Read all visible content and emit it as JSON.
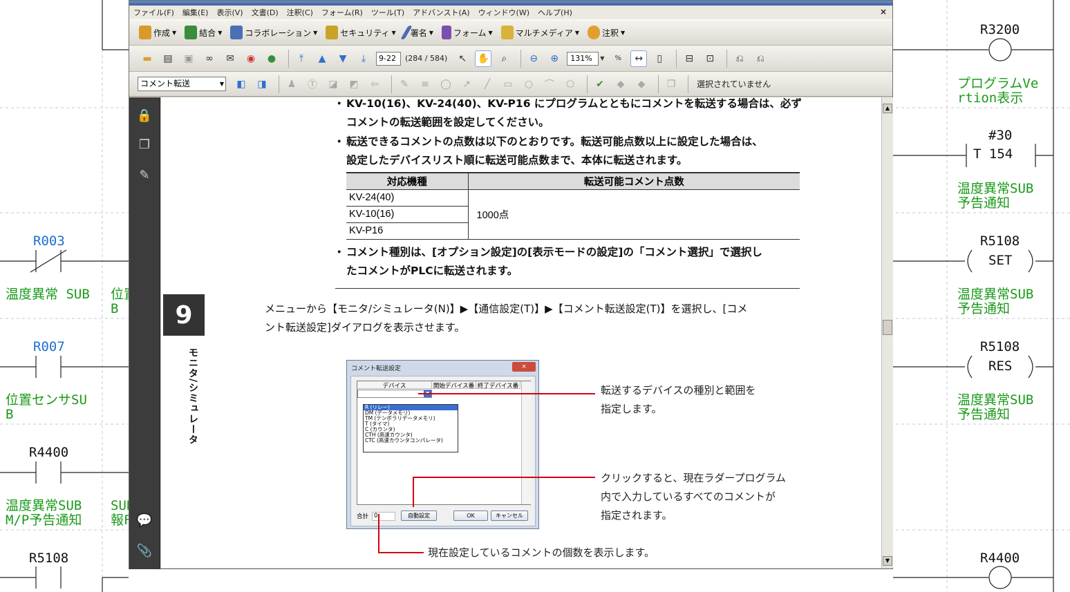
{
  "ladder": {
    "left_labels": [
      {
        "text": "R003",
        "color": "#1e6fd0"
      },
      {
        "text": "温度異常 SUB",
        "color": "#1a9a1a"
      },
      {
        "text": "位置\nB",
        "color": "#1a9a1a"
      },
      {
        "text": "R007",
        "color": "#1e6fd0"
      },
      {
        "text": "位置センサSU\nB",
        "color": "#1a9a1a"
      },
      {
        "text": "R4400",
        "color": "#111111"
      },
      {
        "text": "温度異常SUB\nM/P予告通知",
        "color": "#1a9a1a"
      },
      {
        "text": "SUB\n報F",
        "color": "#1a9a1a"
      },
      {
        "text": "R5108",
        "color": "#111111"
      }
    ],
    "right_labels": [
      {
        "text": "R3200",
        "color": "#111111"
      },
      {
        "text": "プログラムVe\nrtion表示",
        "color": "#1a9a1a"
      },
      {
        "text": "#30",
        "color": "#111111"
      },
      {
        "text": "T 154",
        "color": "#111111"
      },
      {
        "text": "温度異常SUB\n予告通知",
        "color": "#1a9a1a"
      },
      {
        "text": "R5108",
        "color": "#111111"
      },
      {
        "text": "SET",
        "color": "#111111"
      },
      {
        "text": "温度異常SUB\n予告通知",
        "color": "#1a9a1a"
      },
      {
        "text": "R5108",
        "color": "#111111"
      },
      {
        "text": "RES",
        "color": "#111111"
      },
      {
        "text": "温度異常SUB\n予告通知",
        "color": "#1a9a1a"
      },
      {
        "text": "R4400",
        "color": "#111111"
      }
    ]
  },
  "acrobat": {
    "menu": [
      "ファイル(F)",
      "編集(E)",
      "表示(V)",
      "文書(D)",
      "注釈(C)",
      "フォーム(R)",
      "ツール(T)",
      "アドバンスト(A)",
      "ウィンドウ(W)",
      "ヘルプ(H)"
    ],
    "menu_close": "×",
    "tasks": [
      {
        "label": "作成",
        "icon": "create-pdf-icon",
        "color": "#d89a2b"
      },
      {
        "label": "結合",
        "icon": "combine-icon",
        "color": "#3a8d3a"
      },
      {
        "label": "コラボレーション",
        "icon": "collaboration-icon",
        "color": "#4a6fb5"
      },
      {
        "label": "セキュリティ",
        "icon": "lock-icon",
        "color": "#c9a227"
      },
      {
        "label": "署名",
        "icon": "pen-icon",
        "color": "#4c6ab0"
      },
      {
        "label": "フォーム",
        "icon": "form-icon",
        "color": "#7a4fb0"
      },
      {
        "label": "マルチメディア",
        "icon": "multimedia-icon",
        "color": "#d8b23a"
      },
      {
        "label": "注釈",
        "icon": "comment-icon",
        "color": "#e0a030"
      }
    ],
    "page_current": "9-22",
    "page_count": "(284 / 584)",
    "zoom": "131%",
    "combo_value": "コメント転送",
    "status": "選択されていません"
  },
  "doc": {
    "bullets": [
      {
        "line1": "KV-10(16)、KV-24(40)、KV-P16 にプログラムとともにコメントを転送する場合は、必ず",
        "line2": "コメントの転送範囲を設定してください。"
      },
      {
        "line1": "転送できるコメントの点数は以下のとおりです。転送可能点数以上に設定した場合は、",
        "line2": "設定したデバイスリスト順に転送可能点数まで、本体に転送されます。"
      },
      {
        "line1": "コメント種別は、[オプション設定]の[表示モードの設定]の「コメント選択」で選択し",
        "line2": "たコメントがPLCに転送されます。"
      }
    ],
    "table": {
      "headers": [
        "対応機種",
        "転送可能コメント点数"
      ],
      "models": [
        "KV-24(40)",
        "KV-10(16)",
        "KV-P16"
      ],
      "value": "1000点"
    },
    "instruction_line1": "メニューから【モニタ/シミュレータ(N)】▶【通信設定(T)】▶【コメント転送設定(T)】を選択し、[コメ",
    "instruction_line2": "ント転送設定]ダイアログを表示させます。",
    "chapter_number": "9",
    "chapter_title": "モニタ/シミュレータ",
    "dialog": {
      "title": "コメント転送設定",
      "close": "×",
      "col_device": "デバイス",
      "col_start": "開始デバイス番",
      "col_end": "終了デバイス番",
      "list": [
        "R (リレー)",
        "DM (データメモリ)",
        "TM (テンポラリデータメモリ)",
        "T (タイマ)",
        "C (カウンタ)",
        "CTH (高速カウンタ)",
        "CTC (高速カウンタコンパレータ)"
      ],
      "total_label": "合計",
      "total_value": "0",
      "auto_button": "自動設定",
      "ok_button": "OK",
      "cancel_button": "キャンセル"
    },
    "callouts": [
      {
        "line1": "転送するデバイスの種別と範囲を",
        "line2": "指定します。"
      },
      {
        "line1": "クリックすると、現在ラダープログラム",
        "line2": "内で入力しているすべてのコメントが",
        "line3": "指定されます。"
      },
      {
        "line1": "現在設定しているコメントの個数を表示します。"
      }
    ]
  }
}
